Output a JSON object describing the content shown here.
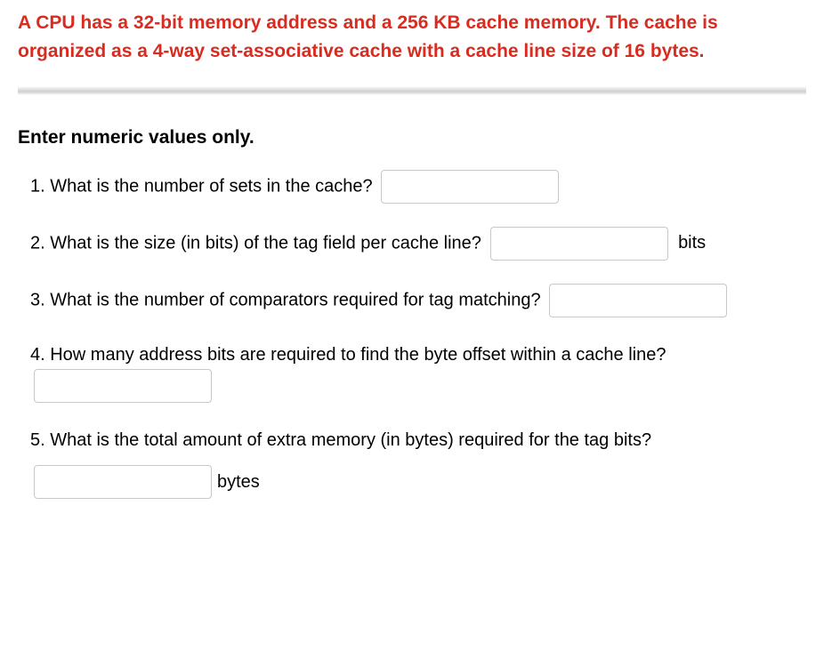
{
  "header": {
    "prompt": "A CPU has a 32-bit memory address and a  256 KB cache memory. The cache is organized as a  4-way set-associative cache with a cache line size of 16 bytes."
  },
  "instruction": "Enter numeric values only.",
  "questions": {
    "q1": {
      "text": "1. What is the number of sets in the cache?",
      "value": ""
    },
    "q2": {
      "text": "2. What is the size (in bits) of the tag field per cache line?",
      "value": "",
      "unit": "bits"
    },
    "q3": {
      "text": "3. What is the number of comparators required for tag matching?",
      "value": ""
    },
    "q4": {
      "text": "4. How many address bits are required to find the byte offset within a cache line?",
      "value": ""
    },
    "q5": {
      "text": "5. What is the total amount of extra memory (in bytes) required for the tag bits?",
      "value": "",
      "unit": "bytes"
    }
  }
}
